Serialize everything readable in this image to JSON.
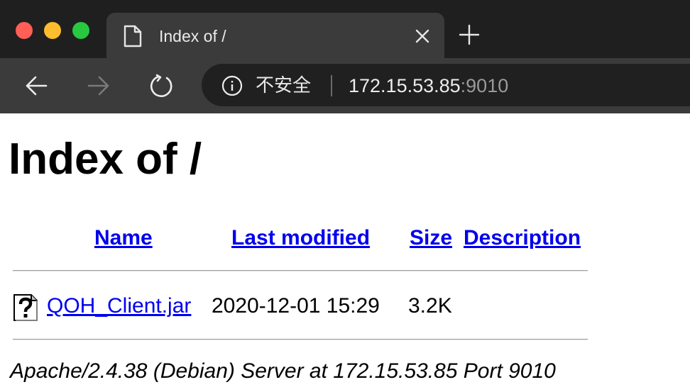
{
  "window": {
    "tab_title": "Index of /"
  },
  "toolbar": {
    "security_label": "不安全",
    "url_host": "172.15.53.85",
    "url_port": ":9010"
  },
  "page": {
    "heading": "Index of /",
    "columns": {
      "name": "Name",
      "last_modified": "Last modified",
      "size": "Size",
      "description": "Description"
    },
    "files": [
      {
        "name": "QOH_Client.jar",
        "last_modified": "2020-12-01 15:29",
        "size": "3.2K",
        "description": ""
      }
    ],
    "address": "Apache/2.4.38 (Debian) Server at 172.15.53.85 Port 9010"
  },
  "icons": {
    "tab": "document-icon",
    "close": "close-icon",
    "new_tab": "plus-icon",
    "back": "arrow-left-icon",
    "forward": "arrow-right-icon",
    "reload": "reload-icon",
    "security": "info-icon",
    "file": "unknown-file-icon"
  },
  "colors": {
    "link": "#0000ee",
    "tabstrip_bg": "#1f1f1f",
    "toolbar_bg": "#3b3b3b",
    "omnibox_bg": "#202020"
  }
}
